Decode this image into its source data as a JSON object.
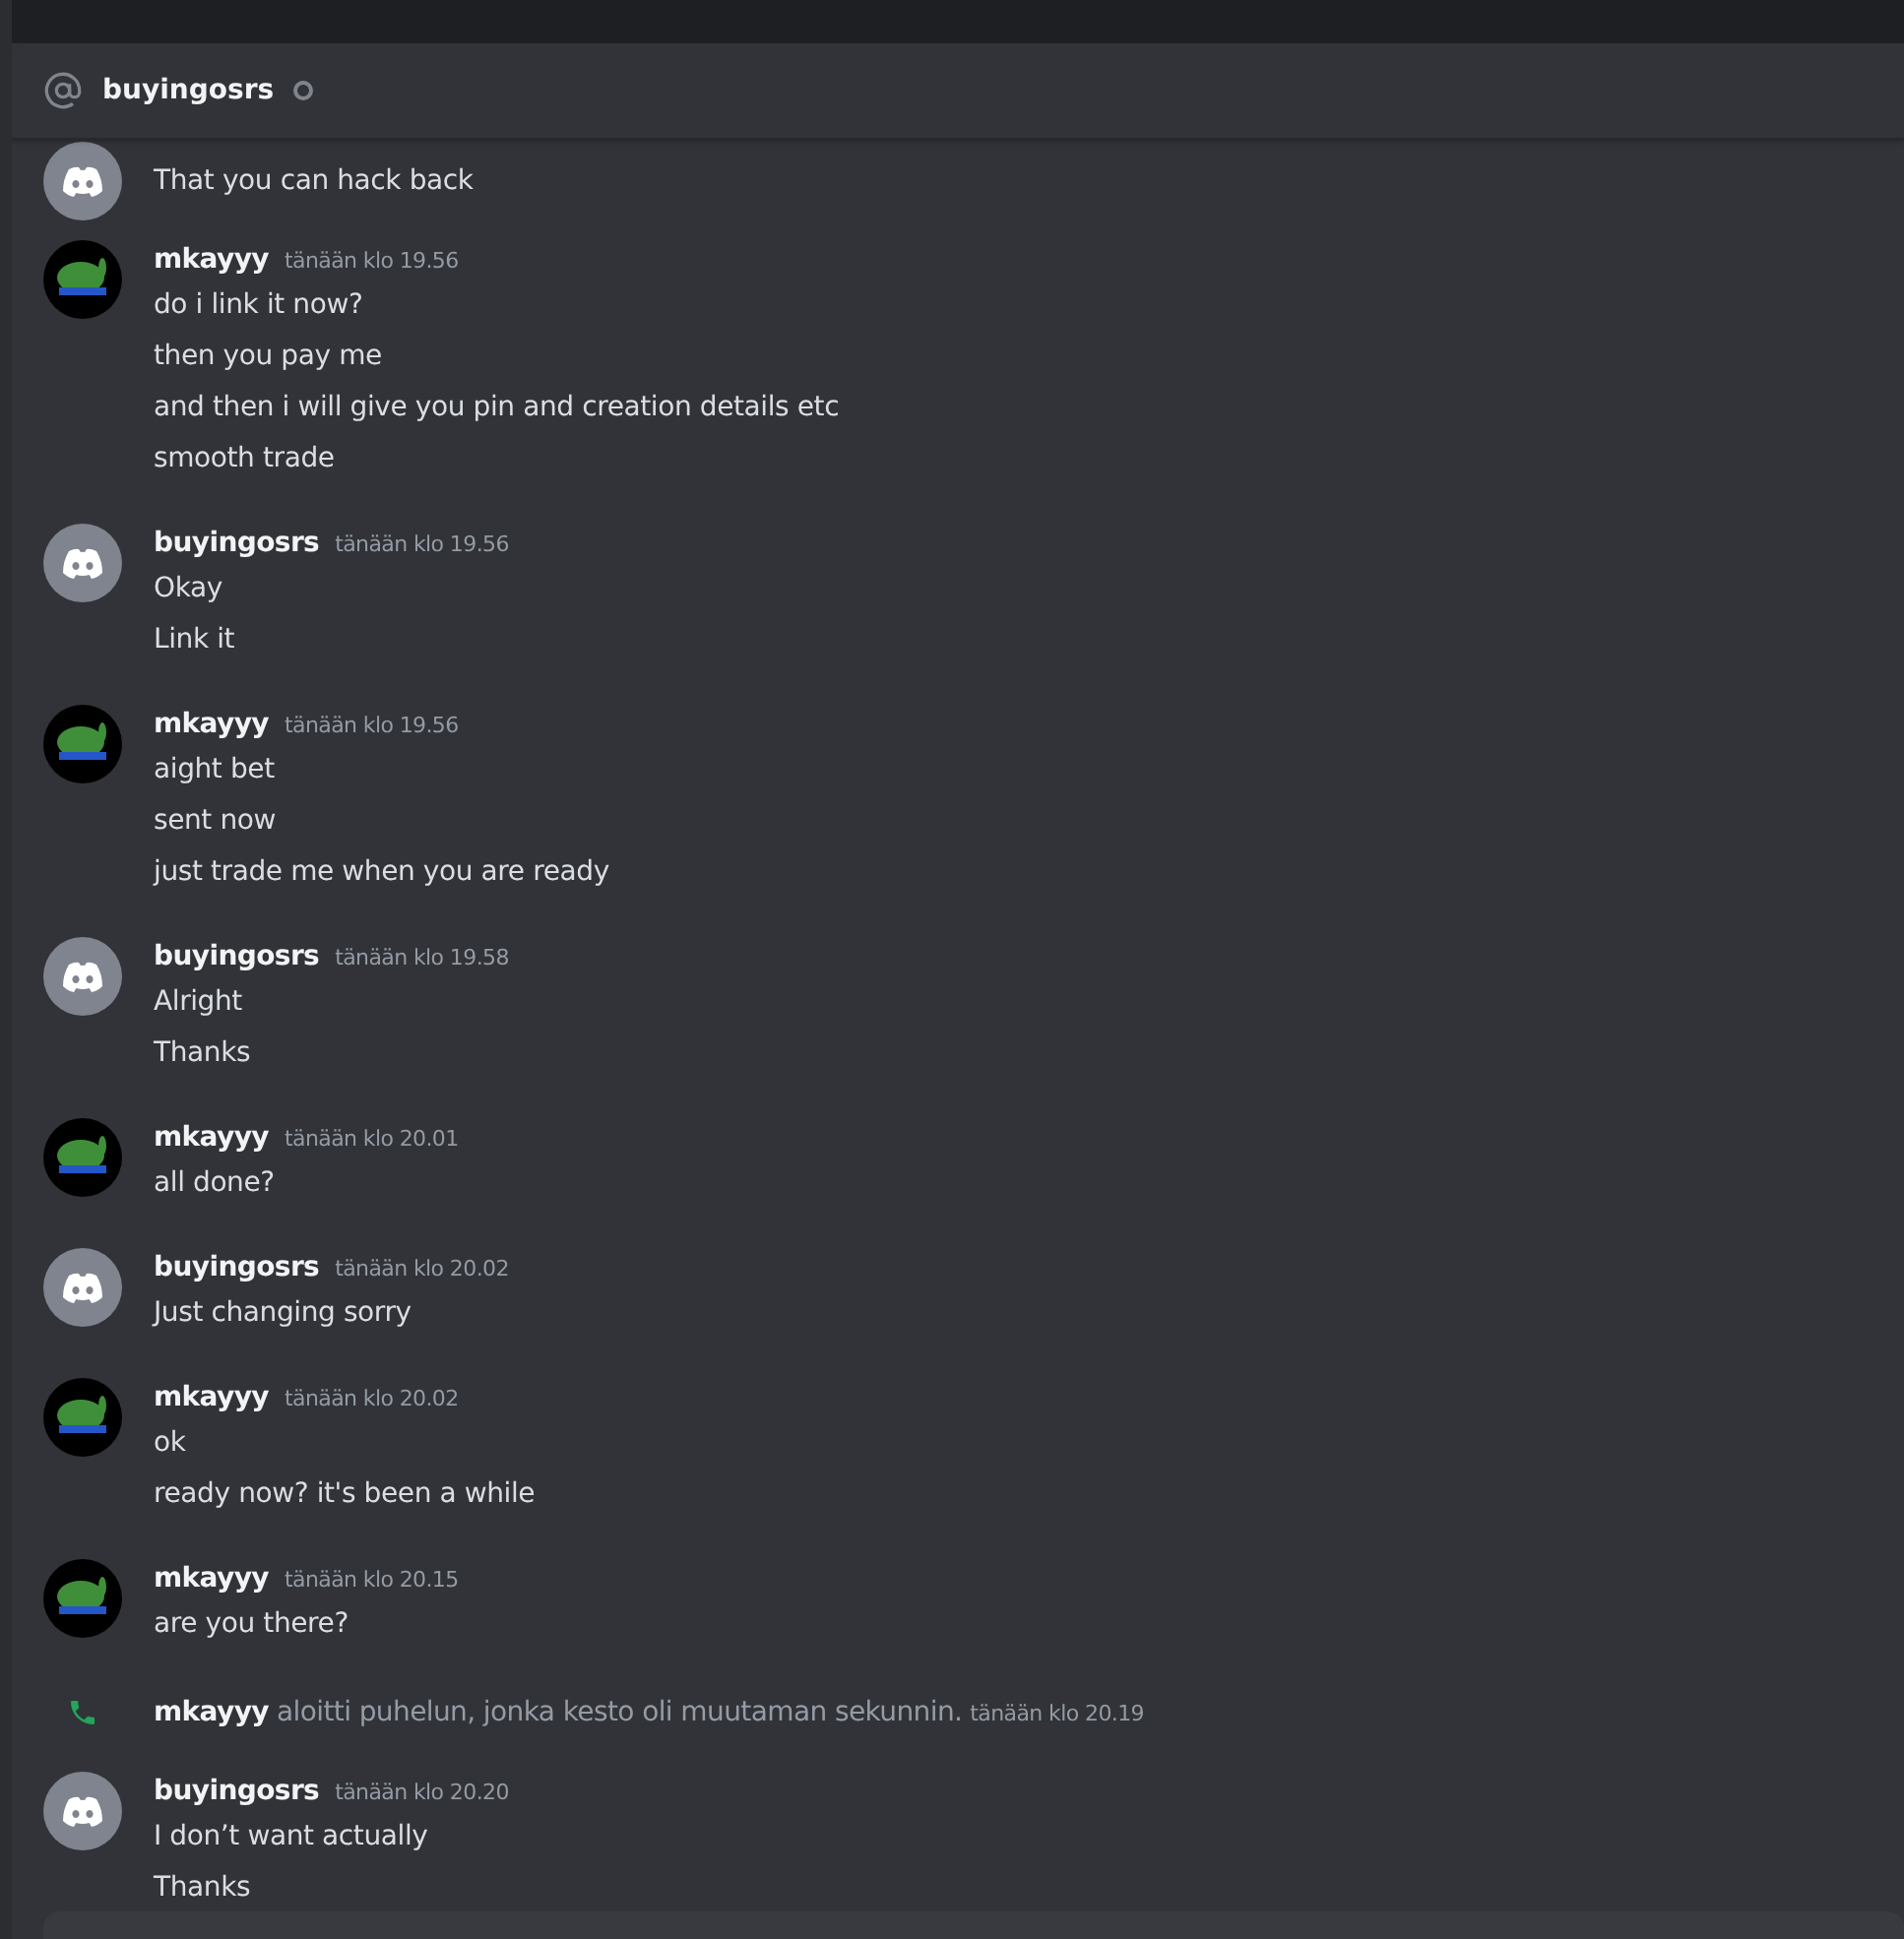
{
  "channel_header": {
    "name": "buyingosrs",
    "online": false
  },
  "messages": [
    {
      "kind": "message",
      "avatar": {
        "kind": "default"
      },
      "lines": [
        "That you can hack back"
      ]
    },
    {
      "kind": "message",
      "avatar": {
        "kind": "custom"
      },
      "author": "mkayyy",
      "timestamp": "tänään klo 19.56",
      "lines": [
        "do i link it now?",
        "then you pay me",
        "and then i will give you pin and creation details etc",
        "smooth trade"
      ]
    },
    {
      "kind": "message",
      "avatar": {
        "kind": "default"
      },
      "author": "buyingosrs",
      "timestamp": "tänään klo 19.56",
      "lines": [
        "Okay",
        "Link it"
      ]
    },
    {
      "kind": "message",
      "avatar": {
        "kind": "custom"
      },
      "author": "mkayyy",
      "timestamp": "tänään klo 19.56",
      "lines": [
        "aight bet",
        "sent now",
        "just trade me when you are ready"
      ]
    },
    {
      "kind": "message",
      "avatar": {
        "kind": "default"
      },
      "author": "buyingosrs",
      "timestamp": "tänään klo 19.58",
      "lines": [
        "Alright",
        "Thanks"
      ]
    },
    {
      "kind": "message",
      "avatar": {
        "kind": "custom"
      },
      "author": "mkayyy",
      "timestamp": "tänään klo 20.01",
      "lines": [
        "all done?"
      ]
    },
    {
      "kind": "message",
      "avatar": {
        "kind": "default"
      },
      "author": "buyingosrs",
      "timestamp": "tänään klo 20.02",
      "lines": [
        "Just changing sorry"
      ]
    },
    {
      "kind": "message",
      "avatar": {
        "kind": "custom"
      },
      "author": "mkayyy",
      "timestamp": "tänään klo 20.02",
      "lines": [
        "ok",
        "ready now? it's been a while"
      ]
    },
    {
      "kind": "message",
      "avatar": {
        "kind": "custom"
      },
      "author": "mkayyy",
      "timestamp": "tänään klo 20.15",
      "lines": [
        "are you there?"
      ]
    },
    {
      "kind": "call",
      "author": "mkayyy",
      "text": "aloitti puhelun, jonka kesto oli muutaman sekunnin.",
      "timestamp": "tänään klo 20.19"
    },
    {
      "kind": "message",
      "avatar": {
        "kind": "default"
      },
      "author": "buyingosrs",
      "timestamp": "tänään klo 20.20",
      "lines": [
        "I don’t want actually",
        "Thanks"
      ]
    }
  ]
}
